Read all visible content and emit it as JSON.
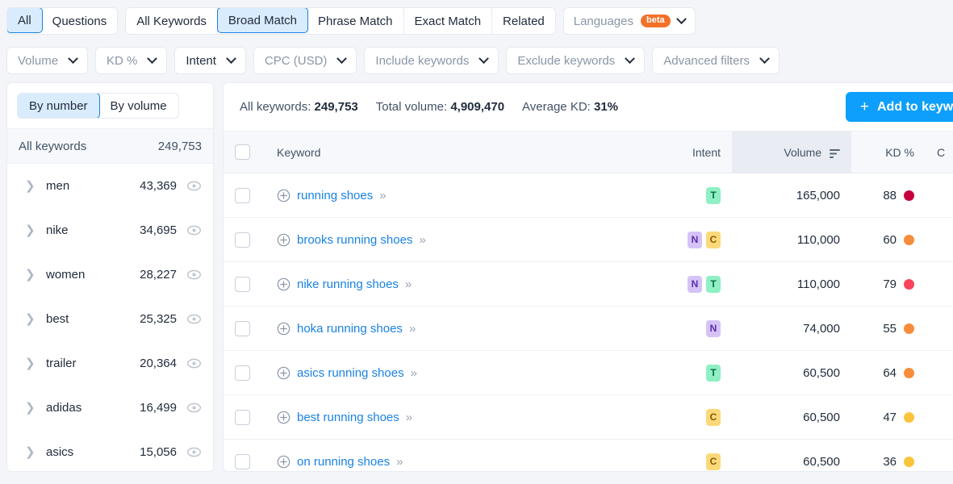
{
  "toolbar": {
    "question_group": [
      {
        "label": "All",
        "active": true
      },
      {
        "label": "Questions",
        "active": false
      }
    ],
    "match_group": [
      {
        "label": "All Keywords",
        "active": false
      },
      {
        "label": "Broad Match",
        "active": true
      },
      {
        "label": "Phrase Match",
        "active": false
      },
      {
        "label": "Exact Match",
        "active": false
      },
      {
        "label": "Related",
        "active": false
      }
    ],
    "languages": {
      "label": "Languages",
      "badge": "beta"
    },
    "filters": [
      {
        "label": "Volume",
        "muted": true
      },
      {
        "label": "KD %",
        "muted": true
      },
      {
        "label": "Intent",
        "muted": false
      },
      {
        "label": "CPC (USD)",
        "muted": true
      },
      {
        "label": "Include keywords",
        "muted": true
      },
      {
        "label": "Exclude keywords",
        "muted": true
      },
      {
        "label": "Advanced filters",
        "muted": true
      }
    ]
  },
  "sidebar": {
    "toggle": [
      {
        "label": "By number",
        "active": true
      },
      {
        "label": "By volume",
        "active": false
      }
    ],
    "all_row": {
      "label": "All keywords",
      "count": "249,753"
    },
    "items": [
      {
        "label": "men",
        "count": "43,369"
      },
      {
        "label": "nike",
        "count": "34,695"
      },
      {
        "label": "women",
        "count": "28,227"
      },
      {
        "label": "best",
        "count": "25,325"
      },
      {
        "label": "trailer",
        "count": "20,364"
      },
      {
        "label": "adidas",
        "count": "16,499"
      },
      {
        "label": "asics",
        "count": "15,056"
      }
    ]
  },
  "main": {
    "stats": {
      "all_keywords_label": "All keywords:",
      "all_keywords_value": "249,753",
      "total_volume_label": "Total volume:",
      "total_volume_value": "4,909,470",
      "average_kd_label": "Average KD:",
      "average_kd_value": "31%"
    },
    "add_button": {
      "plus": "+",
      "label": "Add to keyword"
    },
    "columns": {
      "keyword": "Keyword",
      "intent": "Intent",
      "volume": "Volume",
      "kd": "KD %",
      "cpc": "C"
    },
    "sorted_column": "volume",
    "rows": [
      {
        "keyword": "running shoes",
        "chevron": "»",
        "intent": [
          "T"
        ],
        "volume": "165,000",
        "kd": "88",
        "kd_color": "#c6003c"
      },
      {
        "keyword": "brooks running shoes",
        "chevron": "»",
        "intent": [
          "N",
          "C"
        ],
        "volume": "110,000",
        "kd": "60",
        "kd_color": "#f88c3a"
      },
      {
        "keyword": "nike running shoes",
        "chevron": "»",
        "intent": [
          "N",
          "T"
        ],
        "volume": "110,000",
        "kd": "79",
        "kd_color": "#f8435b"
      },
      {
        "keyword": "hoka running shoes",
        "chevron": "»",
        "intent": [
          "N"
        ],
        "volume": "74,000",
        "kd": "55",
        "kd_color": "#f88c3a"
      },
      {
        "keyword": "asics running shoes",
        "chevron": "»",
        "intent": [
          "T"
        ],
        "volume": "60,500",
        "kd": "64",
        "kd_color": "#f88c3a"
      },
      {
        "keyword": "best running shoes",
        "chevron": "»",
        "intent": [
          "C"
        ],
        "volume": "60,500",
        "kd": "47",
        "kd_color": "#fac43c"
      },
      {
        "keyword": "on running shoes",
        "chevron": "»",
        "intent": [
          "C"
        ],
        "volume": "60,500",
        "kd": "36",
        "kd_color": "#fac43c"
      }
    ]
  },
  "colors": {
    "accent_blue": "#1a82e2",
    "button_blue": "#0d9ffb",
    "beta_orange": "#f4712a",
    "page_bg": "#f3f5f9"
  }
}
